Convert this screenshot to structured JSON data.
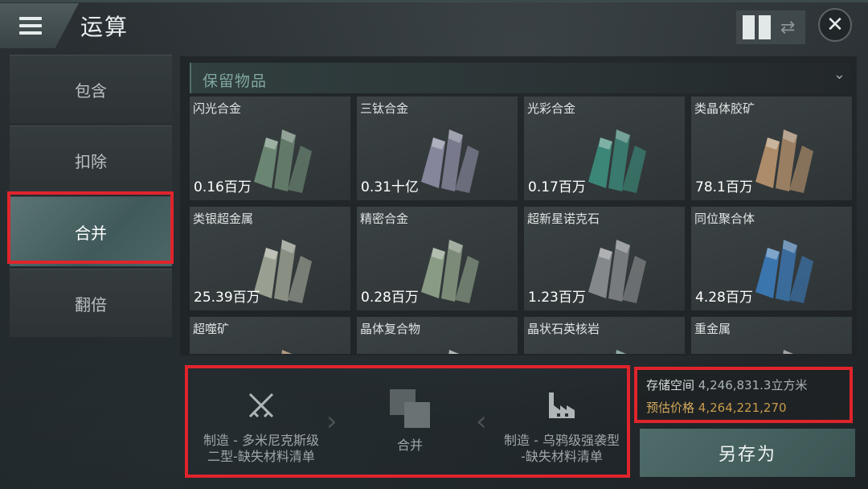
{
  "header": {
    "title": "运算"
  },
  "sidebar": {
    "items": [
      {
        "label": "包含"
      },
      {
        "label": "扣除"
      },
      {
        "label": "合并"
      },
      {
        "label": "翻倍"
      }
    ]
  },
  "panel": {
    "title": "保留物品",
    "items": [
      {
        "name": "闪光合金",
        "qty": "0.16百万",
        "color": "#6e8a76"
      },
      {
        "name": "三钛合金",
        "qty": "0.31十亿",
        "color": "#8a8aa0"
      },
      {
        "name": "光彩合金",
        "qty": "0.17百万",
        "color": "#3c8a7a"
      },
      {
        "name": "类晶体胶矿",
        "qty": "78.1百万",
        "color": "#b4906c"
      },
      {
        "name": "类银超金属",
        "qty": "25.39百万",
        "color": "#a0a596"
      },
      {
        "name": "精密合金",
        "qty": "0.28百万",
        "color": "#8ea088"
      },
      {
        "name": "超新星诺克石",
        "qty": "1.23百万",
        "color": "#8a8c8e"
      },
      {
        "name": "同位聚合体",
        "qty": "4.28百万",
        "color": "#3c78b4"
      },
      {
        "name": "超噬矿",
        "qty": "",
        "color": "#a87a50"
      },
      {
        "name": "晶体复合物",
        "qty": "",
        "color": "#a4b0b0"
      },
      {
        "name": "晶状石英核岩",
        "qty": "",
        "color": "#6a9a92"
      },
      {
        "name": "重金属",
        "qty": "",
        "color": "#8c8c8c"
      }
    ]
  },
  "flow": {
    "left_line1": "制造 - 多米尼克斯级",
    "left_line2": "二型-缺失材料清单",
    "middle": "合并",
    "right_line1": "制造 - 乌鸦级强袭型",
    "right_line2": "-缺失材料清单"
  },
  "storage": {
    "space_label": "存储空间",
    "space_value": "4,246,831.3立方米",
    "price_label": "预估价格",
    "price_value": "4,264,221,270"
  },
  "save_button": "另存为"
}
